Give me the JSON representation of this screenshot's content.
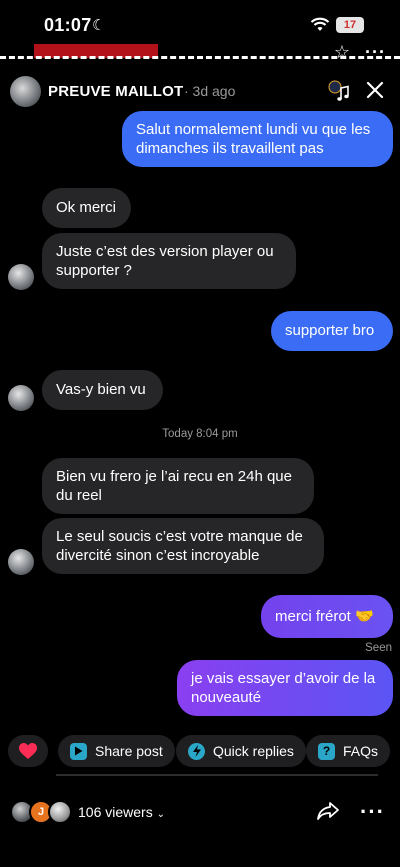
{
  "status_bar": {
    "time": "01:07",
    "battery": "17"
  },
  "header": {
    "name": "PREUVE MAILLOT",
    "ago": "· 3d ago"
  },
  "messages": [
    {
      "dir": "out",
      "text": "Salut normalement lundi vu que les dimanches ils travaillent pas"
    },
    {
      "dir": "in",
      "text": "Ok merci"
    },
    {
      "dir": "in",
      "text": "Juste c’est des version player ou supporter ?"
    },
    {
      "dir": "out",
      "text": "supporter bro"
    },
    {
      "dir": "in",
      "text": "Vas-y bien vu"
    },
    {
      "dir": "in",
      "text": "Bien vu frero je l’ai recu en 24h que du reel"
    },
    {
      "dir": "in",
      "text": "Le seul soucis c’est votre manque de divercité sinon c’est incroyable"
    },
    {
      "dir": "out",
      "text": "merci frérot 🤝"
    },
    {
      "dir": "out",
      "text": "je vais essayer d’avoir de la nouveauté"
    }
  ],
  "timestamp": "Today 8:04 pm",
  "seen": "Seen",
  "quick_actions": {
    "share_post": "Share post",
    "quick_replies": "Quick replies",
    "faqs": "FAQs"
  },
  "viewers": {
    "initial": "J",
    "count": "106 viewers"
  },
  "colors": {
    "accent": "#3b6cf5",
    "gradient_start": "#7b3ff2",
    "incoming": "#262628"
  }
}
